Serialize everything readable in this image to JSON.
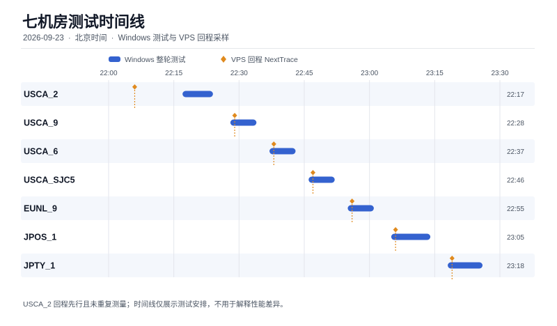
{
  "title": "七机房测试时间线",
  "subtitle": {
    "date": "2026-09-23",
    "timezone": "北京时间",
    "description": "Windows 测试与 VPS 回程采样"
  },
  "footnote": "USCA_2 回程先行且未重复测量；时间线仅展示测试安排，不用于解释性能差异。",
  "colors": {
    "bar": "#3462cf",
    "marker": "#e08a1e",
    "row_band": "#f4f7fc",
    "grid": "#e3e6ec"
  },
  "chart_data": {
    "type": "timeline",
    "legend": [
      {
        "label": "Windows 整轮测试",
        "kind": "bar",
        "color": "#3462cf"
      },
      {
        "label": "VPS 回程 NextTrace",
        "kind": "diamond",
        "color": "#e08a1e"
      }
    ],
    "x_ticks": [
      "22:00",
      "22:15",
      "22:30",
      "22:45",
      "23:00",
      "23:15",
      "23:30"
    ],
    "x_range": [
      "22:00",
      "23:30"
    ],
    "rows": [
      {
        "name": "USCA_2",
        "bar_start": "22:17",
        "bar_end": "22:24",
        "trace": "22:06",
        "end_label": "22:17"
      },
      {
        "name": "USCA_9",
        "bar_start": "22:28",
        "bar_end": "22:34",
        "trace": "22:29",
        "end_label": "22:28"
      },
      {
        "name": "USCA_6",
        "bar_start": "22:37",
        "bar_end": "22:43",
        "trace": "22:38",
        "end_label": "22:37"
      },
      {
        "name": "USCA_SJC5",
        "bar_start": "22:46",
        "bar_end": "22:52",
        "trace": "22:47",
        "end_label": "22:46"
      },
      {
        "name": "EUNL_9",
        "bar_start": "22:55",
        "bar_end": "23:01",
        "trace": "22:56",
        "end_label": "22:55"
      },
      {
        "name": "JPOS_1",
        "bar_start": "23:05",
        "bar_end": "23:14",
        "trace": "23:06",
        "end_label": "23:05"
      },
      {
        "name": "JPTY_1",
        "bar_start": "23:18",
        "bar_end": "23:26",
        "trace": "23:19",
        "end_label": "23:18"
      }
    ]
  }
}
